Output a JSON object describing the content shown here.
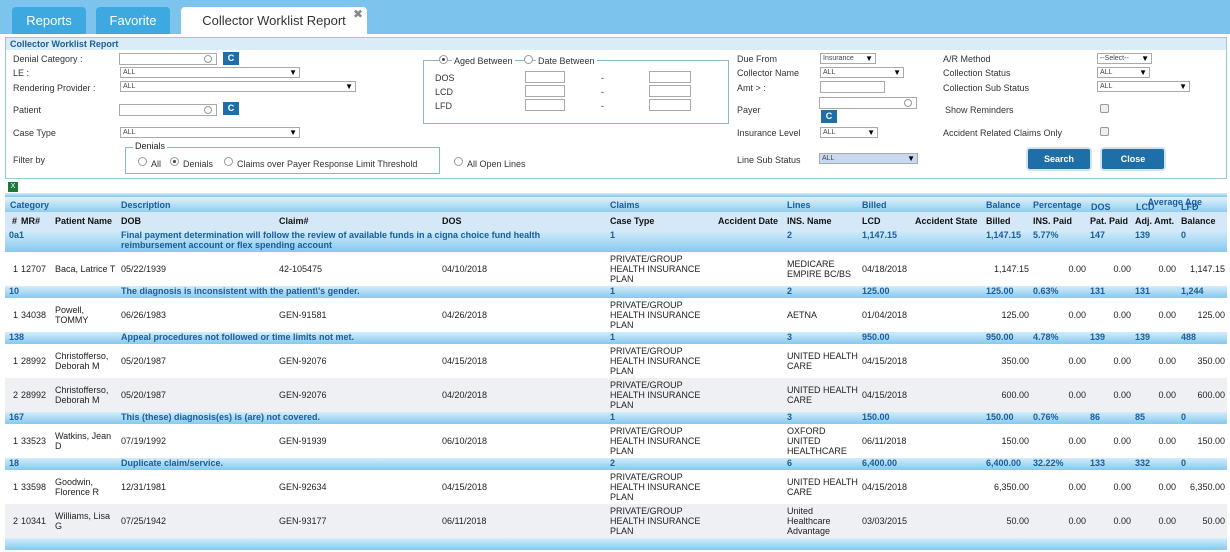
{
  "tabs": [
    {
      "label": "Reports"
    },
    {
      "label": "Favorite"
    },
    {
      "label": "Collector Worklist Report"
    }
  ],
  "filter": {
    "title": "Collector Worklist Report",
    "denial_category_label": "Denial Category :",
    "le_label": "LE :",
    "le_value": "ALL",
    "rendering_label": "Rendering Provider :",
    "rendering_value": "ALL",
    "patient_label": "Patient",
    "case_type_label": "Case Type",
    "case_type_value": "ALL",
    "filter_by_label": "Filter by",
    "denials_group": "Denials",
    "radio_all": "All",
    "radio_denials": "Denials",
    "radio_claims": "Claims over Payer Response Limit Threshold",
    "radio_open": "All Open Lines",
    "aged_between": "Aged Between",
    "date_between": "Date Between",
    "dos": "DOS",
    "lcd": "LCD",
    "lfd": "LFD",
    "dash": "-",
    "due_from_label": "Due From",
    "due_from_value": "Insurance",
    "collector_label": "Collector Name",
    "collector_value": "ALL",
    "amt_label": "Amt > :",
    "payer_label": "Payer",
    "ins_level_label": "Insurance Level",
    "ins_level_value": "ALL",
    "line_sub_label": "Line Sub Status",
    "line_sub_value": "ALL",
    "ar_method_label": "A/R Method",
    "ar_method_value": "--Select--",
    "coll_status_label": "Collection Status",
    "coll_status_value": "ALL",
    "coll_sub_label": "Collection Sub Status",
    "coll_sub_value": "ALL",
    "reminders_label": "Show Reminders",
    "accident_label": "Accident Related Claims Only",
    "c_label": "C",
    "search": "Search",
    "close": "Close"
  },
  "table": {
    "excel_icon": "X",
    "h1": {
      "category": "Category",
      "description": "Description",
      "claims": "Claims",
      "lines": "Lines",
      "billed": "Billed",
      "balance": "Balance",
      "percentage": "Percentage",
      "avg_age": "Average Age"
    },
    "h_age": {
      "dos": "DOS",
      "lcd": "LCD",
      "lfd": "LFD"
    },
    "h2": {
      "num": "#",
      "mr": "MR#",
      "patient": "Patient Name",
      "dob": "DOB",
      "claim": "Claim#",
      "dos": "DOS",
      "case_type": "Case Type",
      "accident_date": "Accident Date",
      "ins_name": "INS. Name",
      "lcd": "LCD",
      "accident_state": "Accident State",
      "billed": "Billed",
      "ins_paid": "INS. Paid",
      "pat_paid": "Pat. Paid",
      "adj_amt": "Adj. Amt.",
      "balance": "Balance"
    },
    "groups": [
      {
        "cat": "0a1",
        "desc": "Final payment determination will follow the review of available funds in a cigna choice fund health reimbursement account or flex spending account",
        "claims": "1",
        "lines": "2",
        "billed": "1,147.15",
        "balance": "1,147.15",
        "pct": "5.77%",
        "dos": "147",
        "lcd": "139",
        "lfd": "0",
        "rows": [
          {
            "n": "1",
            "mr": "12707",
            "pt": "Baca, Latrice T",
            "dob": "05/22/1939",
            "claim": "42-105475",
            "dos": "04/10/2018",
            "case": "PRIVATE/GROUP HEALTH INSURANCE PLAN",
            "ins": "MEDICARE EMPIRE BC/BS",
            "lcd": "04/18/2018",
            "billed": "1,147.15",
            "ins_paid": "0.00",
            "pat_paid": "0.00",
            "adj": "0.00",
            "bal": "1,147.15"
          }
        ]
      },
      {
        "cat": "10",
        "desc": "The diagnosis is inconsistent with the patient\\'s gender.",
        "claims": "1",
        "lines": "2",
        "billed": "125.00",
        "balance": "125.00",
        "pct": "0.63%",
        "dos": "131",
        "lcd": "131",
        "lfd": "1,244",
        "rows": [
          {
            "n": "1",
            "mr": "34038",
            "pt": "Powell, TOMMY",
            "dob": "06/26/1983",
            "claim": "GEN-91581",
            "dos": "04/26/2018",
            "case": "PRIVATE/GROUP HEALTH INSURANCE PLAN",
            "ins": "AETNA",
            "lcd": "01/04/2018",
            "billed": "125.00",
            "ins_paid": "0.00",
            "pat_paid": "0.00",
            "adj": "0.00",
            "bal": "125.00"
          }
        ]
      },
      {
        "cat": "138",
        "desc": "Appeal procedures not followed or time limits not met.",
        "claims": "1",
        "lines": "3",
        "billed": "950.00",
        "balance": "950.00",
        "pct": "4.78%",
        "dos": "139",
        "lcd": "139",
        "lfd": "488",
        "rows": [
          {
            "n": "1",
            "mr": "28992",
            "pt": "Christofferso, Deborah M",
            "dob": "05/20/1987",
            "claim": "GEN-92076",
            "dos": "04/15/2018",
            "case": "PRIVATE/GROUP HEALTH INSURANCE PLAN",
            "ins": "UNITED HEALTH CARE",
            "lcd": "04/15/2018",
            "billed": "350.00",
            "ins_paid": "0.00",
            "pat_paid": "0.00",
            "adj": "0.00",
            "bal": "350.00"
          },
          {
            "n": "2",
            "mr": "28992",
            "pt": "Christofferso, Deborah M",
            "dob": "05/20/1987",
            "claim": "GEN-92076",
            "dos": "04/20/2018",
            "case": "PRIVATE/GROUP HEALTH INSURANCE PLAN",
            "ins": "UNITED HEALTH CARE",
            "lcd": "04/15/2018",
            "billed": "600.00",
            "ins_paid": "0.00",
            "pat_paid": "0.00",
            "adj": "0.00",
            "bal": "600.00"
          }
        ]
      },
      {
        "cat": "167",
        "desc": "This (these) diagnosis(es) is (are) not covered.",
        "claims": "1",
        "lines": "3",
        "billed": "150.00",
        "balance": "150.00",
        "pct": "0.76%",
        "dos": "86",
        "lcd": "85",
        "lfd": "0",
        "rows": [
          {
            "n": "1",
            "mr": "33523",
            "pt": "Watkins, Jean D",
            "dob": "07/19/1992",
            "claim": "GEN-91939",
            "dos": "06/10/2018",
            "case": "PRIVATE/GROUP HEALTH INSURANCE PLAN",
            "ins": "OXFORD UNITED HEALTHCARE",
            "lcd": "06/11/2018",
            "billed": "150.00",
            "ins_paid": "0.00",
            "pat_paid": "0.00",
            "adj": "0.00",
            "bal": "150.00"
          }
        ]
      },
      {
        "cat": "18",
        "desc": "Duplicate claim/service.",
        "claims": "2",
        "lines": "6",
        "billed": "6,400.00",
        "balance": "6,400.00",
        "pct": "32.22%",
        "dos": "133",
        "lcd": "332",
        "lfd": "0",
        "rows": [
          {
            "n": "1",
            "mr": "33598",
            "pt": "Goodwin, Florence R",
            "dob": "12/31/1981",
            "claim": "GEN-92634",
            "dos": "04/15/2018",
            "case": "PRIVATE/GROUP HEALTH INSURANCE PLAN",
            "ins": "UNITED HEALTH CARE",
            "lcd": "04/15/2018",
            "billed": "6,350.00",
            "ins_paid": "0.00",
            "pat_paid": "0.00",
            "adj": "0.00",
            "bal": "6,350.00"
          },
          {
            "n": "2",
            "mr": "10341",
            "pt": "Williams, Lisa G",
            "dob": "07/25/1942",
            "claim": "GEN-93177",
            "dos": "06/11/2018",
            "case": "PRIVATE/GROUP HEALTH INSURANCE PLAN",
            "ins": "United Healthcare Advantage",
            "lcd": "03/03/2015",
            "billed": "50.00",
            "ins_paid": "0.00",
            "pat_paid": "0.00",
            "adj": "0.00",
            "bal": "50.00"
          }
        ]
      }
    ]
  }
}
